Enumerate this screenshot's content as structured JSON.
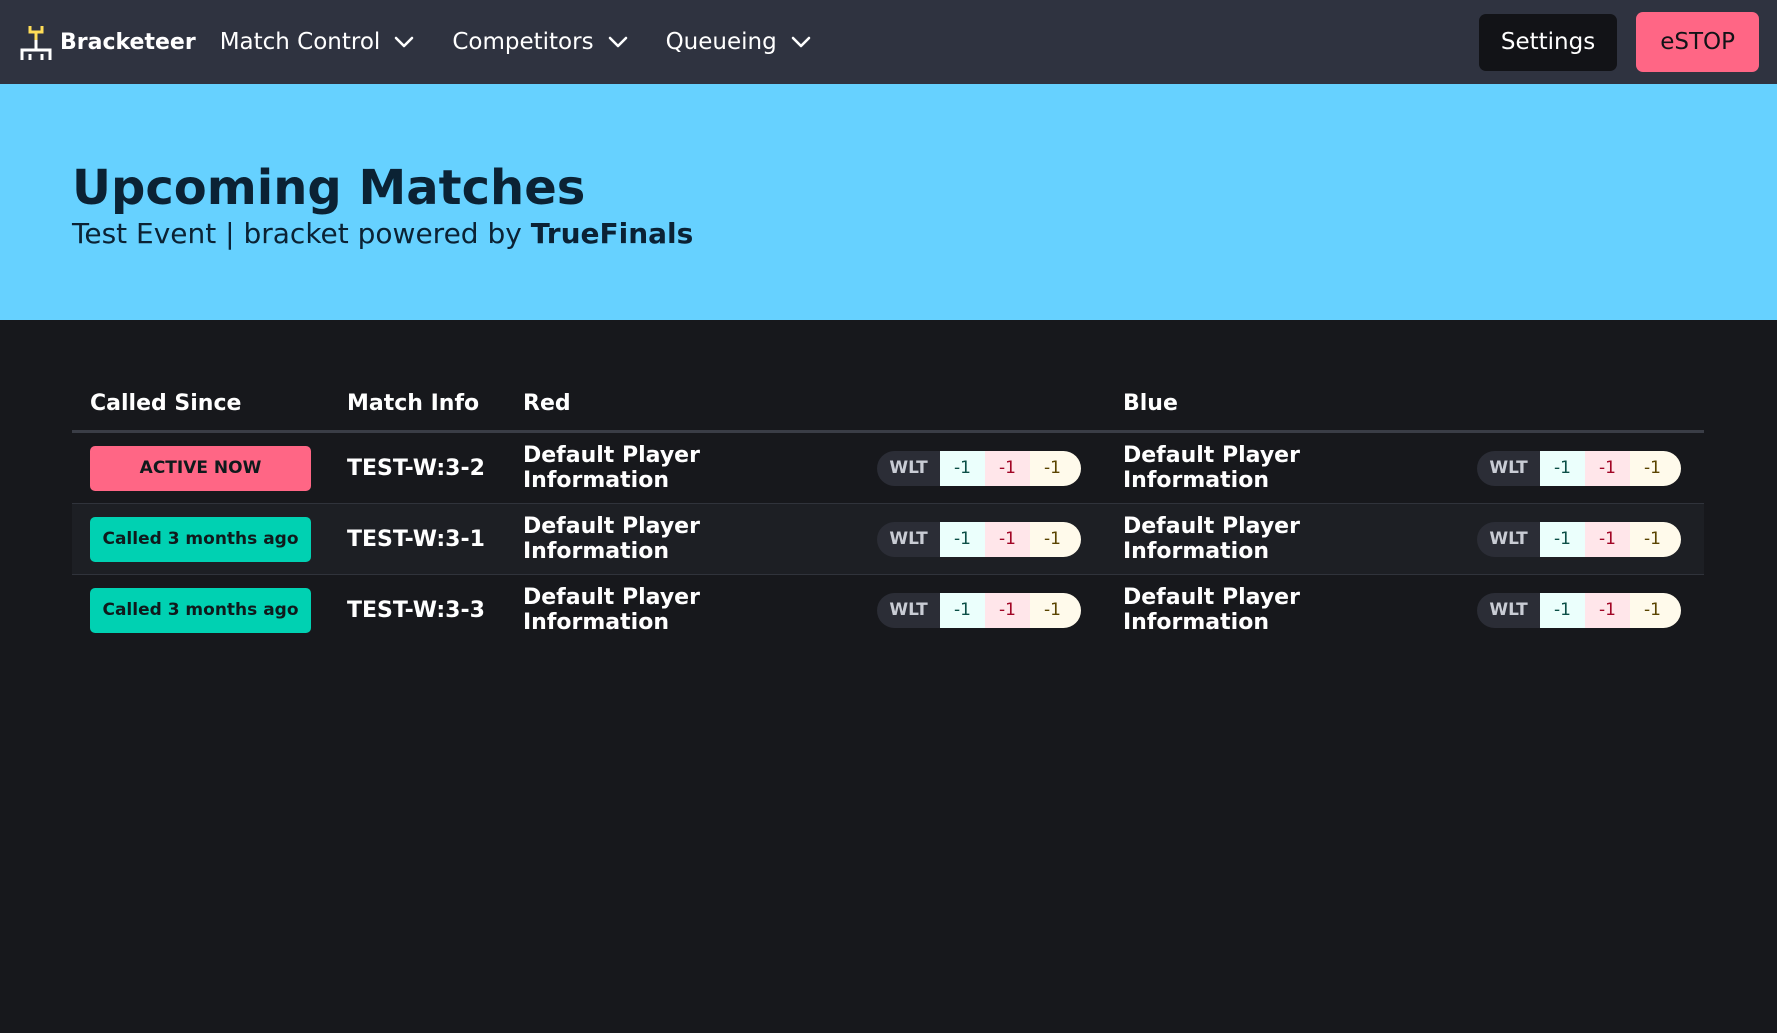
{
  "navbar": {
    "brand": "Bracketeer",
    "menus": [
      {
        "label": "Match Control"
      },
      {
        "label": "Competitors"
      },
      {
        "label": "Queueing"
      }
    ],
    "settings_label": "Settings",
    "estop_label": "eSTOP"
  },
  "hero": {
    "title": "Upcoming Matches",
    "subtitle_prefix": "Test Event | bracket powered by",
    "subtitle_brand": "TrueFinals"
  },
  "table": {
    "headers": {
      "called_since": "Called Since",
      "match_info": "Match Info",
      "red": "Red",
      "blue": "Blue"
    },
    "wlt_label": "WLT",
    "rows": [
      {
        "status": "ACTIVE NOW",
        "match": "TEST-W:3-2",
        "red": {
          "player": "Default Player Information",
          "w": "-1",
          "l": "-1",
          "t": "-1"
        },
        "blue": {
          "player": "Default Player Information",
          "w": "-1",
          "l": "-1",
          "t": "-1"
        }
      },
      {
        "status": "Called 3 months ago",
        "match": "TEST-W:3-1",
        "red": {
          "player": "Default Player Information",
          "w": "-1",
          "l": "-1",
          "t": "-1"
        },
        "blue": {
          "player": "Default Player Information",
          "w": "-1",
          "l": "-1",
          "t": "-1"
        }
      },
      {
        "status": "Called 3 months ago",
        "match": "TEST-W:3-3",
        "red": {
          "player": "Default Player Information",
          "w": "-1",
          "l": "-1",
          "t": "-1"
        },
        "blue": {
          "player": "Default Player Information",
          "w": "-1",
          "l": "-1",
          "t": "-1"
        }
      }
    ]
  },
  "colors": {
    "navbar_bg": "#2f3340",
    "hero_bg": "#66d1ff",
    "page_bg": "#17181c",
    "danger": "#ff6685",
    "success": "#00d1b2",
    "brand_icon": "#ffdd57"
  }
}
